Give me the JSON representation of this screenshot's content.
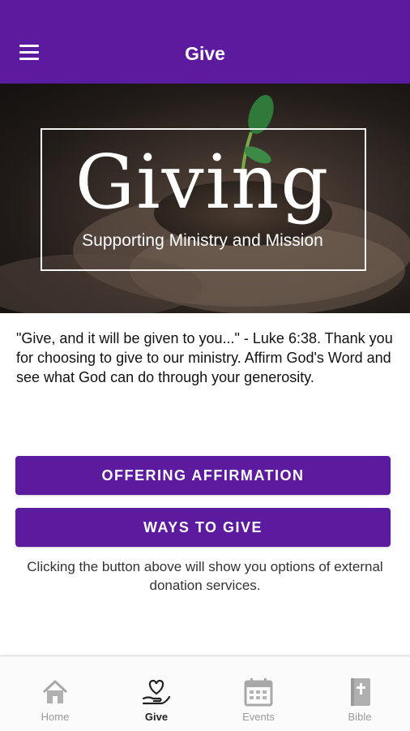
{
  "header": {
    "title": "Give"
  },
  "hero": {
    "title": "Giving",
    "subtitle": "Supporting Ministry and Mission"
  },
  "intro": "\"Give, and it will be given to you...\" - Luke 6:38. Thank you for choosing to give to our ministry. Affirm God's Word and see what God can do through your generosity.",
  "buttons": {
    "offering": "OFFERING AFFIRMATION",
    "ways": "WAYS TO GIVE"
  },
  "note": "Clicking the button above will show you options of external donation services.",
  "tabs": [
    {
      "label": "Home",
      "icon": "home-icon"
    },
    {
      "label": "Give",
      "icon": "give-heart-hand-icon",
      "active": true
    },
    {
      "label": "Events",
      "icon": "calendar-icon"
    },
    {
      "label": "Bible",
      "icon": "bible-icon"
    }
  ],
  "colors": {
    "brand": "#5c1a9e",
    "tab_inactive": "#999999",
    "tab_active": "#222222"
  }
}
